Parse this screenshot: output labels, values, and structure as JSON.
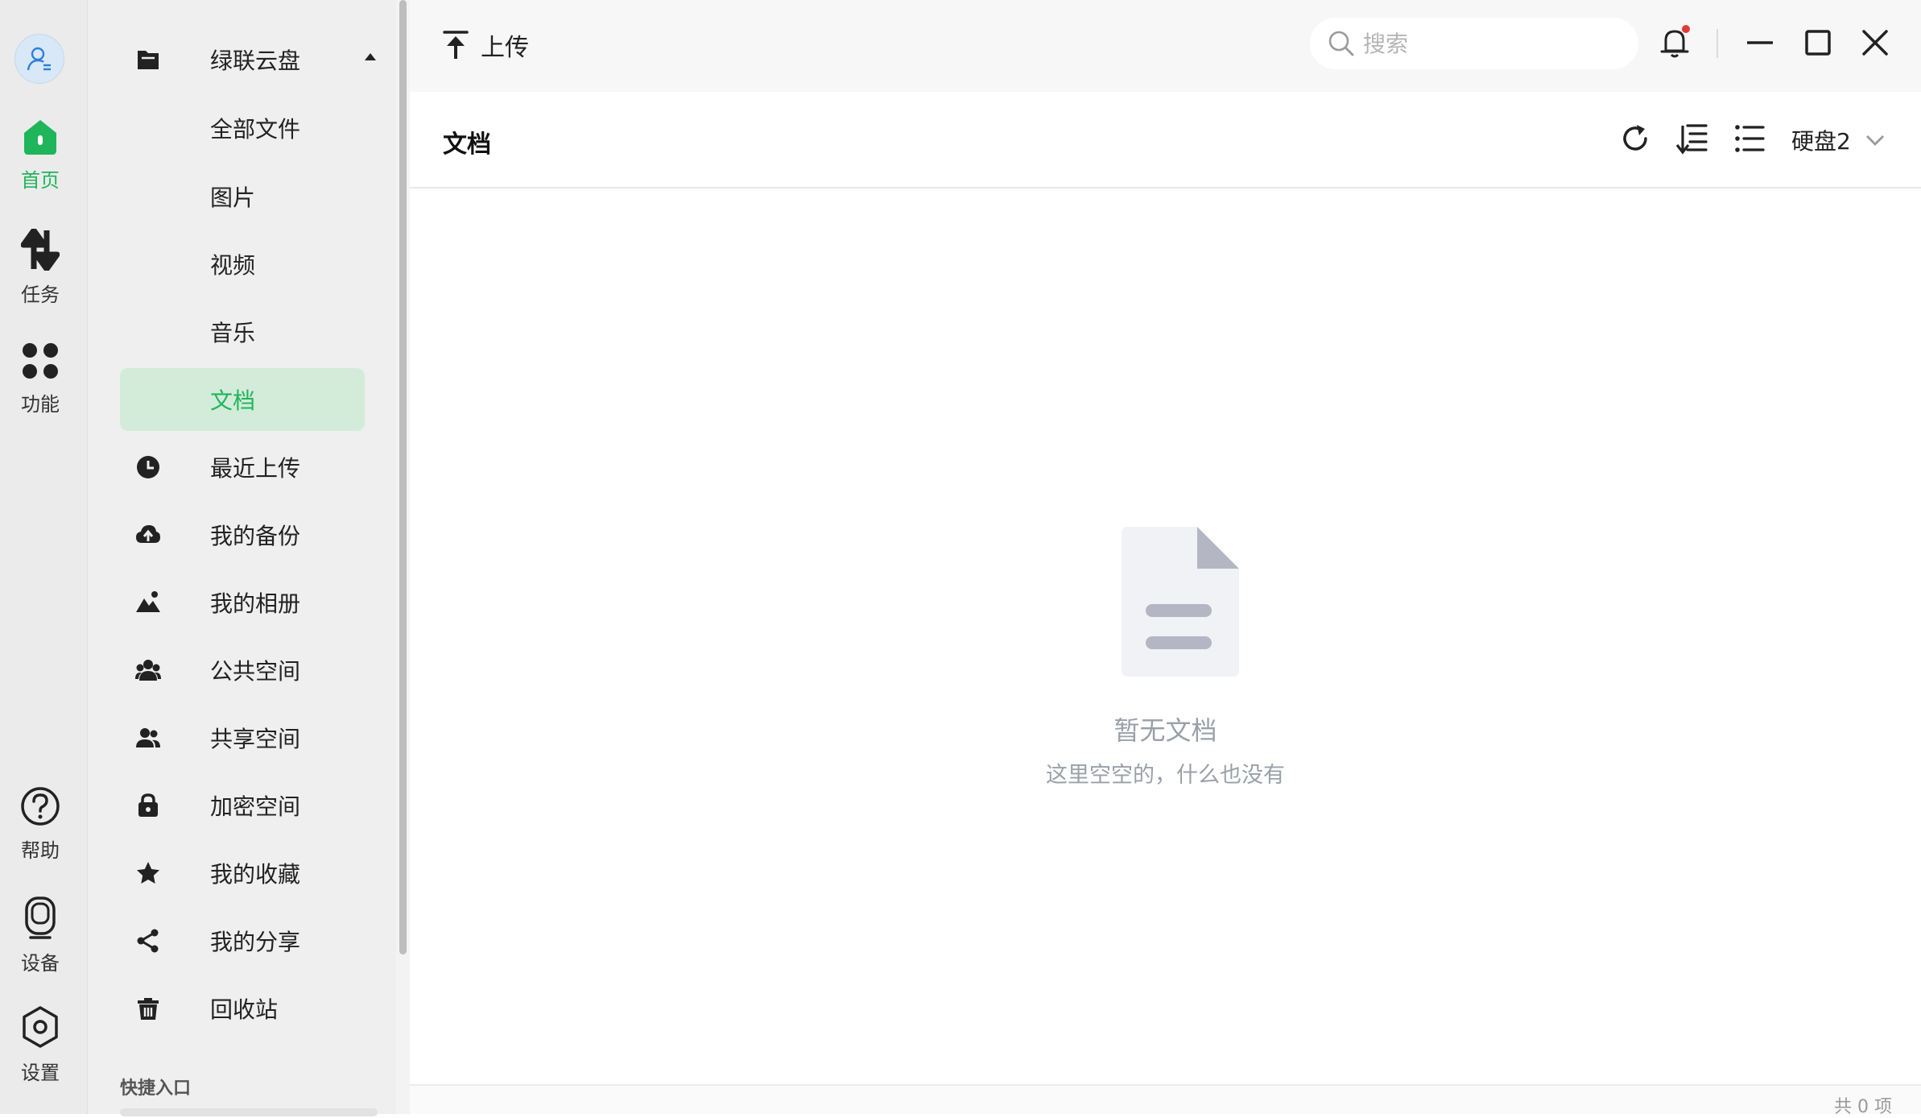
{
  "rail": {
    "items": [
      {
        "label": "首页",
        "icon": "home-icon"
      },
      {
        "label": "任务",
        "icon": "transfer-icon"
      },
      {
        "label": "功能",
        "icon": "apps-icon"
      },
      {
        "label": "帮助",
        "icon": "help-icon"
      },
      {
        "label": "设备",
        "icon": "device-icon"
      },
      {
        "label": "设置",
        "icon": "settings-icon"
      }
    ],
    "active": "首页"
  },
  "sidebar": {
    "root": {
      "label": "绿联云盘",
      "icon": "folder-icon"
    },
    "subitems": [
      "全部文件",
      "图片",
      "视频",
      "音乐",
      "文档"
    ],
    "active_sub": "文档",
    "items": [
      {
        "label": "最近上传",
        "icon": "clock-icon"
      },
      {
        "label": "我的备份",
        "icon": "cloud-upload-icon"
      },
      {
        "label": "我的相册",
        "icon": "mountain-icon"
      },
      {
        "label": "公共空间",
        "icon": "group-icon"
      },
      {
        "label": "共享空间",
        "icon": "users-icon"
      },
      {
        "label": "加密空间",
        "icon": "lock-icon"
      },
      {
        "label": "我的收藏",
        "icon": "star-icon"
      },
      {
        "label": "我的分享",
        "icon": "share-icon"
      },
      {
        "label": "回收站",
        "icon": "trash-icon"
      }
    ],
    "quick_access": "快捷入口"
  },
  "topbar": {
    "upload_label": "上传",
    "search_placeholder": "搜索"
  },
  "header": {
    "title": "文档",
    "disk": "硬盘2"
  },
  "empty": {
    "title": "暂无文档",
    "subtitle": "这里空空的，什么也没有"
  },
  "status": {
    "count": "共 0 项"
  },
  "colors": {
    "accent": "#1fb55b",
    "active_bg": "#d3ecd9",
    "notification_dot": "#e53935"
  }
}
